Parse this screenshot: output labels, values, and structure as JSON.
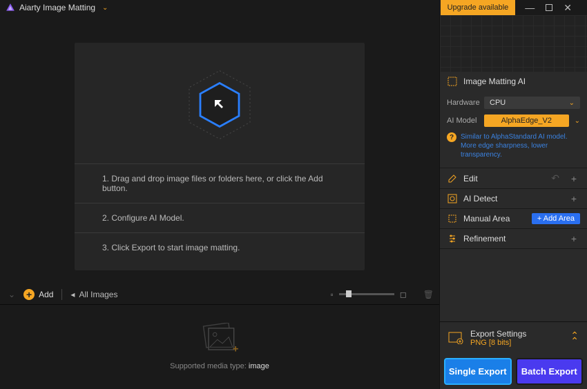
{
  "titlebar": {
    "app_name": "Aiarty Image Matting",
    "upgrade_label": "Upgrade available"
  },
  "drop": {
    "step1": "1. Drag and drop image files or folders here, or click the Add button.",
    "step2": "2. Configure AI Model.",
    "step3": "3. Click Export to start image matting."
  },
  "thumb_bar": {
    "add_label": "Add",
    "all_images_label": "All Images",
    "media_type_label": "Supported media type:",
    "media_type_value": "image"
  },
  "panels": {
    "ai": {
      "title": "Image Matting AI",
      "hardware_label": "Hardware",
      "hardware_value": "CPU",
      "model_label": "AI Model",
      "model_value": "AlphaEdge_V2",
      "model_desc": "Similar to AlphaStandard AI model. More edge sharpness, lower transparency."
    },
    "edit": {
      "title": "Edit"
    },
    "detect": {
      "title": "AI Detect"
    },
    "manual": {
      "title": "Manual Area",
      "add_area_label": "+ Add Area"
    },
    "refine": {
      "title": "Refinement"
    }
  },
  "export": {
    "settings_title": "Export Settings",
    "format": "PNG   [8 bits]",
    "single_label": "Single Export",
    "batch_label": "Batch Export"
  }
}
